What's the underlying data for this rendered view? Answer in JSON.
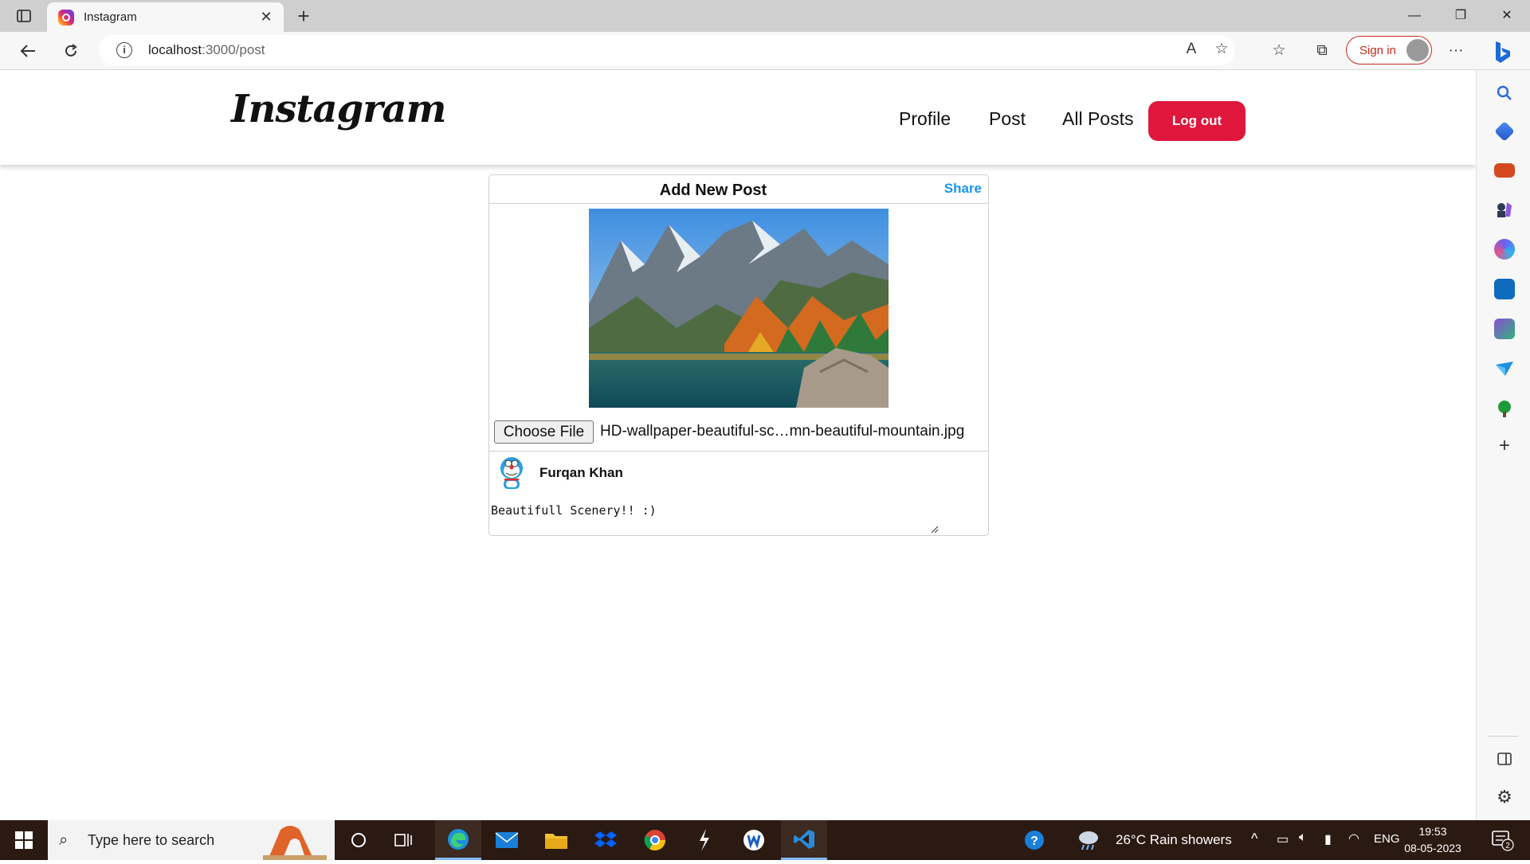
{
  "browser": {
    "tab_title": "Instagram",
    "url_host": "localhost",
    "url_path": ":3000/post",
    "sign_in_label": "Sign in",
    "accent_color": "#c42b1c"
  },
  "app": {
    "logo": "Instagram",
    "nav": {
      "profile": "Profile",
      "post": "Post",
      "all_posts": "All Posts",
      "logout": "Log out"
    },
    "logout_color": "#e0173c"
  },
  "card": {
    "title": "Add New Post",
    "share_label": "Share",
    "share_color": "#1a95e8",
    "choose_file_label": "Choose File",
    "file_name": "HD-wallpaper-beautiful-sc…mn-beautiful-mountain.jpg",
    "user_name": "Furqan Khan",
    "caption": "Beautifull Scenery!! :)"
  },
  "taskbar": {
    "search_placeholder": "Type here to search",
    "weather": "26°C  Rain showers",
    "language": "ENG",
    "time": "19:53",
    "date": "08-05-2023",
    "notification_count": "2"
  }
}
